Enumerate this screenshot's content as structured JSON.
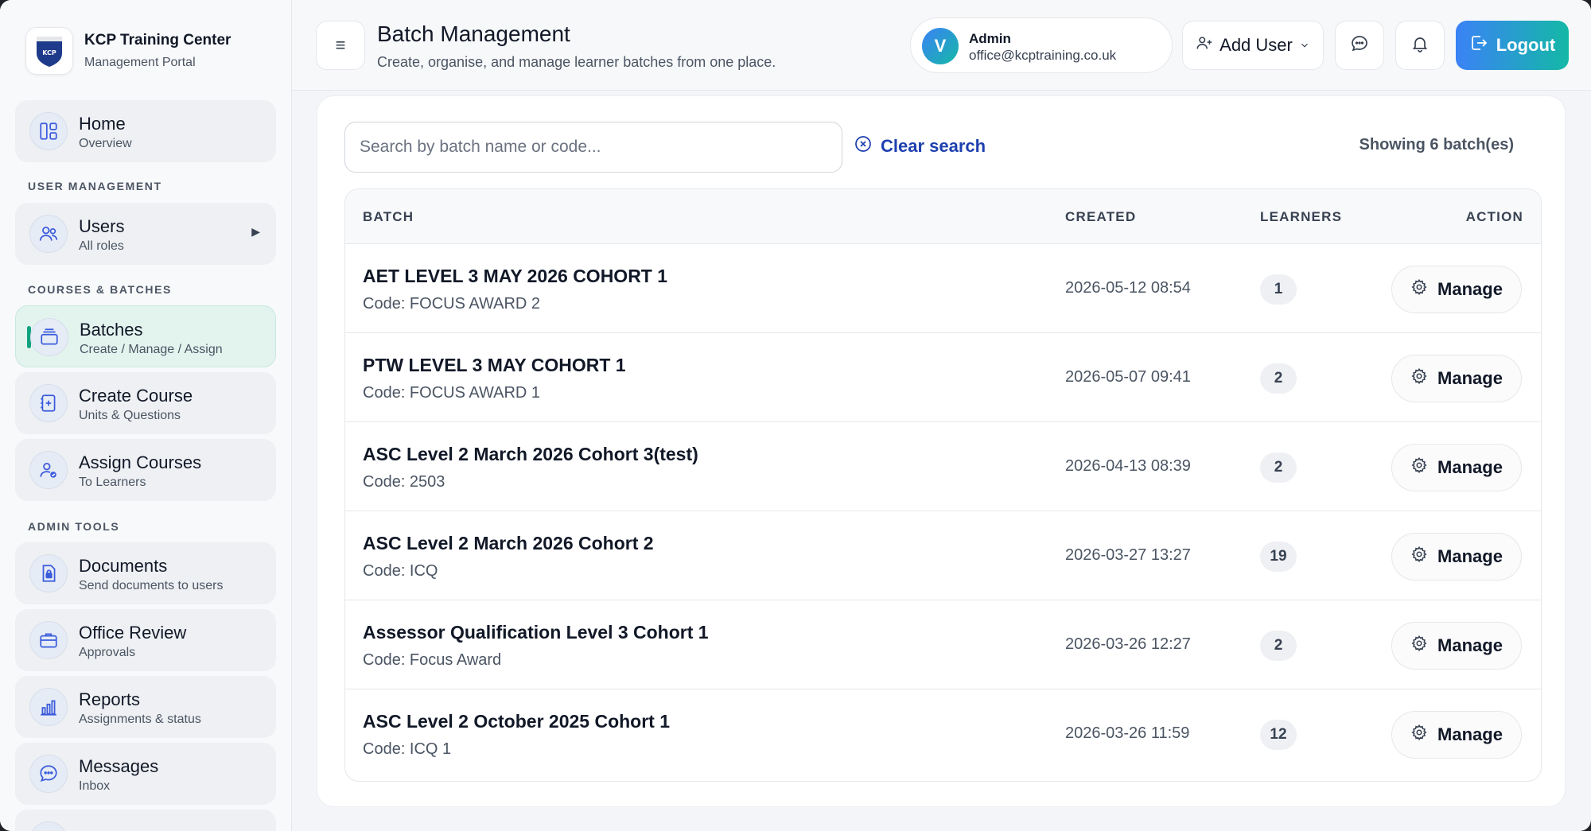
{
  "brand": {
    "title": "KCP Training Center",
    "subtitle": "Management Portal",
    "logo_text": "KCP"
  },
  "sidebar": {
    "home": {
      "label": "Home",
      "sub": "Overview"
    },
    "sections": {
      "user_management": "USER MANAGEMENT",
      "courses_batches": "COURSES & BATCHES",
      "admin_tools": "ADMIN TOOLS"
    },
    "users": {
      "label": "Users",
      "sub": "All roles",
      "arrow": "▶"
    },
    "batches": {
      "label": "Batches",
      "sub": "Create / Manage / Assign"
    },
    "create_course": {
      "label": "Create Course",
      "sub": "Units & Questions"
    },
    "assign_courses": {
      "label": "Assign Courses",
      "sub": "To Learners"
    },
    "documents": {
      "label": "Documents",
      "sub": "Send documents to users"
    },
    "office_review": {
      "label": "Office Review",
      "sub": "Approvals"
    },
    "reports": {
      "label": "Reports",
      "sub": "Assignments & status"
    },
    "messages": {
      "label": "Messages",
      "sub": "Inbox"
    }
  },
  "header": {
    "menu_glyph": "≡",
    "title": "Batch Management",
    "subtitle": "Create, organise, and manage learner batches from one place.",
    "user": {
      "initial": "V",
      "role": "Admin",
      "email": "office@kcptraining.co.uk"
    },
    "add_user_label": "Add User",
    "logout_label": "Logout"
  },
  "toolbar": {
    "search_placeholder": "Search by batch name or code...",
    "clear_label": "Clear search",
    "showing": "Showing 6 batch(es)"
  },
  "table": {
    "headers": {
      "batch": "BATCH",
      "created": "CREATED",
      "learners": "LEARNERS",
      "action": "ACTION"
    },
    "rows": [
      {
        "name": "AET LEVEL 3 MAY 2026 COHORT 1",
        "code": "Code: FOCUS AWARD 2",
        "created": "2026-05-12 08:54",
        "learners": "1",
        "action": "Manage"
      },
      {
        "name": "PTW LEVEL 3 MAY COHORT 1",
        "code": "Code: FOCUS AWARD 1",
        "created": "2026-05-07 09:41",
        "learners": "2",
        "action": "Manage"
      },
      {
        "name": "ASC Level 2 March 2026 Cohort 3(test)",
        "code": "Code: 2503",
        "created": "2026-04-13 08:39",
        "learners": "2",
        "action": "Manage"
      },
      {
        "name": "ASC Level 2 March 2026 Cohort 2",
        "code": "Code: ICQ",
        "created": "2026-03-27 13:27",
        "learners": "19",
        "action": "Manage"
      },
      {
        "name": "Assessor Qualification Level 3 Cohort 1",
        "code": "Code: Focus Award",
        "created": "2026-03-26 12:27",
        "learners": "2",
        "action": "Manage"
      },
      {
        "name": "ASC Level 2 October 2025 Cohort 1",
        "code": "Code: ICQ 1",
        "created": "2026-03-26 11:59",
        "learners": "12",
        "action": "Manage"
      }
    ]
  },
  "colors": {
    "accent_green": "#10a37f",
    "accent_blue": "#3b82f6",
    "link_blue": "#1e40af"
  }
}
